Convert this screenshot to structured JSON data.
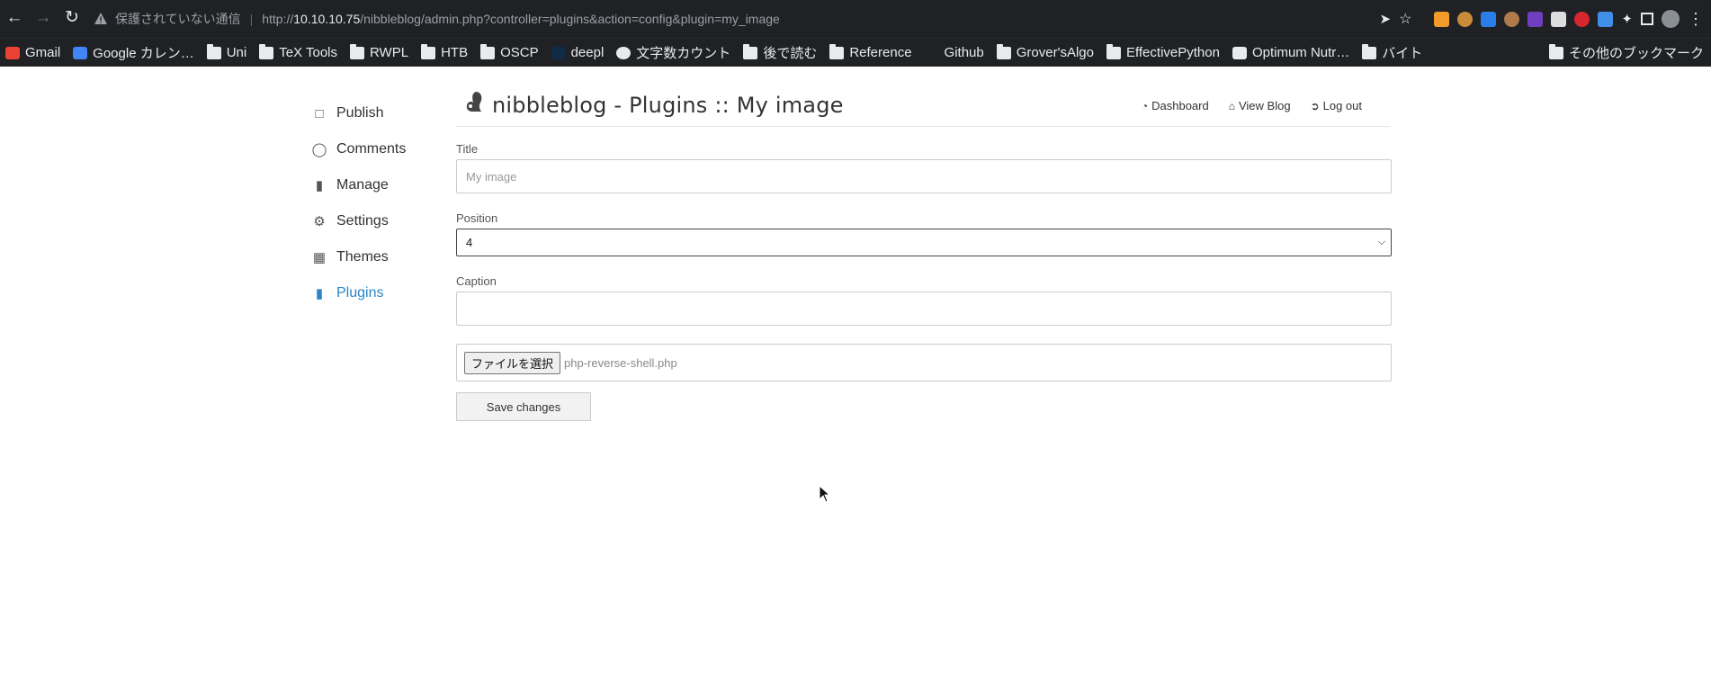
{
  "browser": {
    "security_label": "保護されていない通信",
    "url_prefix": "http://",
    "url_host": "10.10.10.75",
    "url_path": "/nibbleblog/admin.php?controller=plugins&action=config&plugin=my_image"
  },
  "bookmarks": [
    {
      "label": "Gmail",
      "icon": "gmail-icon"
    },
    {
      "label": "Google カレン…",
      "icon": "calendar-icon"
    },
    {
      "label": "Uni",
      "icon": "folder-icon"
    },
    {
      "label": "TeX Tools",
      "icon": "folder-icon"
    },
    {
      "label": "RWPL",
      "icon": "folder-icon"
    },
    {
      "label": "HTB",
      "icon": "folder-icon"
    },
    {
      "label": "OSCP",
      "icon": "folder-icon"
    },
    {
      "label": "deepl",
      "icon": "deepl-icon"
    },
    {
      "label": "文字数カウント",
      "icon": "globe-icon"
    },
    {
      "label": "後で読む",
      "icon": "folder-icon"
    },
    {
      "label": "Reference",
      "icon": "folder-icon"
    },
    {
      "label": "Github",
      "icon": "github-icon"
    },
    {
      "label": "Grover'sAlgo",
      "icon": "folder-icon"
    },
    {
      "label": "EffectivePython",
      "icon": "folder-icon"
    },
    {
      "label": "Optimum Nutr…",
      "icon": "on-icon"
    },
    {
      "label": "バイト",
      "icon": "folder-icon"
    }
  ],
  "bookmarks_other": "その他のブックマーク",
  "sidebar": {
    "items": [
      {
        "label": "Publish",
        "icon": "publish-icon"
      },
      {
        "label": "Comments",
        "icon": "comment-icon"
      },
      {
        "label": "Manage",
        "icon": "folder-icon"
      },
      {
        "label": "Settings",
        "icon": "gear-icon"
      },
      {
        "label": "Themes",
        "icon": "image-icon"
      },
      {
        "label": "Plugins",
        "icon": "folder-icon"
      }
    ],
    "active_color": "#2a86c9"
  },
  "header": {
    "title": "nibbleblog - Plugins :: My image",
    "links": {
      "dashboard": "Dashboard",
      "view_blog": "View Blog",
      "logout": "Log out"
    }
  },
  "form": {
    "title_label": "Title",
    "title_placeholder": "My image",
    "position_label": "Position",
    "position_value": "4",
    "caption_label": "Caption",
    "caption_value": "",
    "file_button": "ファイルを選択",
    "file_name": "php-reverse-shell.php",
    "save_label": "Save changes"
  }
}
